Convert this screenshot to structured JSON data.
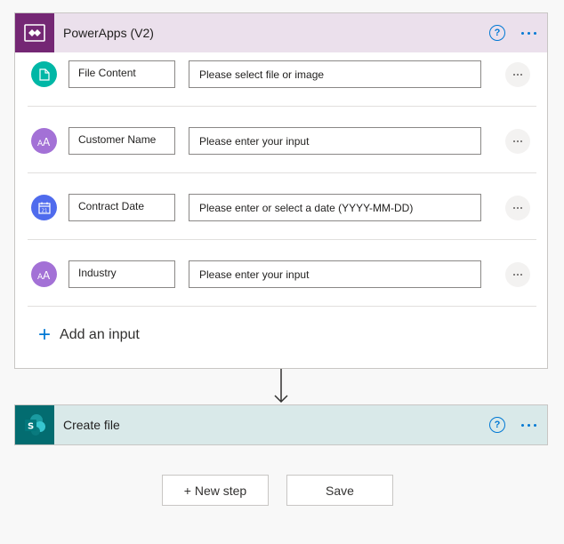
{
  "trigger": {
    "title": "PowerApps (V2)",
    "icon": "powerapps-icon",
    "header_color": "#ebe0ec",
    "icon_bg": "#742774",
    "help_glyph": "?",
    "inputs": [
      {
        "name": "File Content",
        "placeholder": "Please select file or image",
        "icon": "file-icon",
        "icon_color": "#00b7a6"
      },
      {
        "name": "Customer Name",
        "placeholder": "Please enter your input",
        "icon": "text-icon",
        "icon_color": "#a371d6"
      },
      {
        "name": "Contract Date",
        "placeholder": "Please enter or select a date (YYYY-MM-DD)",
        "icon": "calendar-icon",
        "icon_color": "#4f6bed"
      },
      {
        "name": "Industry",
        "placeholder": "Please enter your input",
        "icon": "text-icon",
        "icon_color": "#a371d6"
      }
    ],
    "add_input_label": "Add an input"
  },
  "action": {
    "title": "Create file",
    "icon": "sharepoint-icon",
    "header_color": "#d9e9e9",
    "icon_bg": "#036c70",
    "help_glyph": "?"
  },
  "footer": {
    "new_step_label": "+ New step",
    "save_label": "Save"
  },
  "accent": "#0078d4"
}
